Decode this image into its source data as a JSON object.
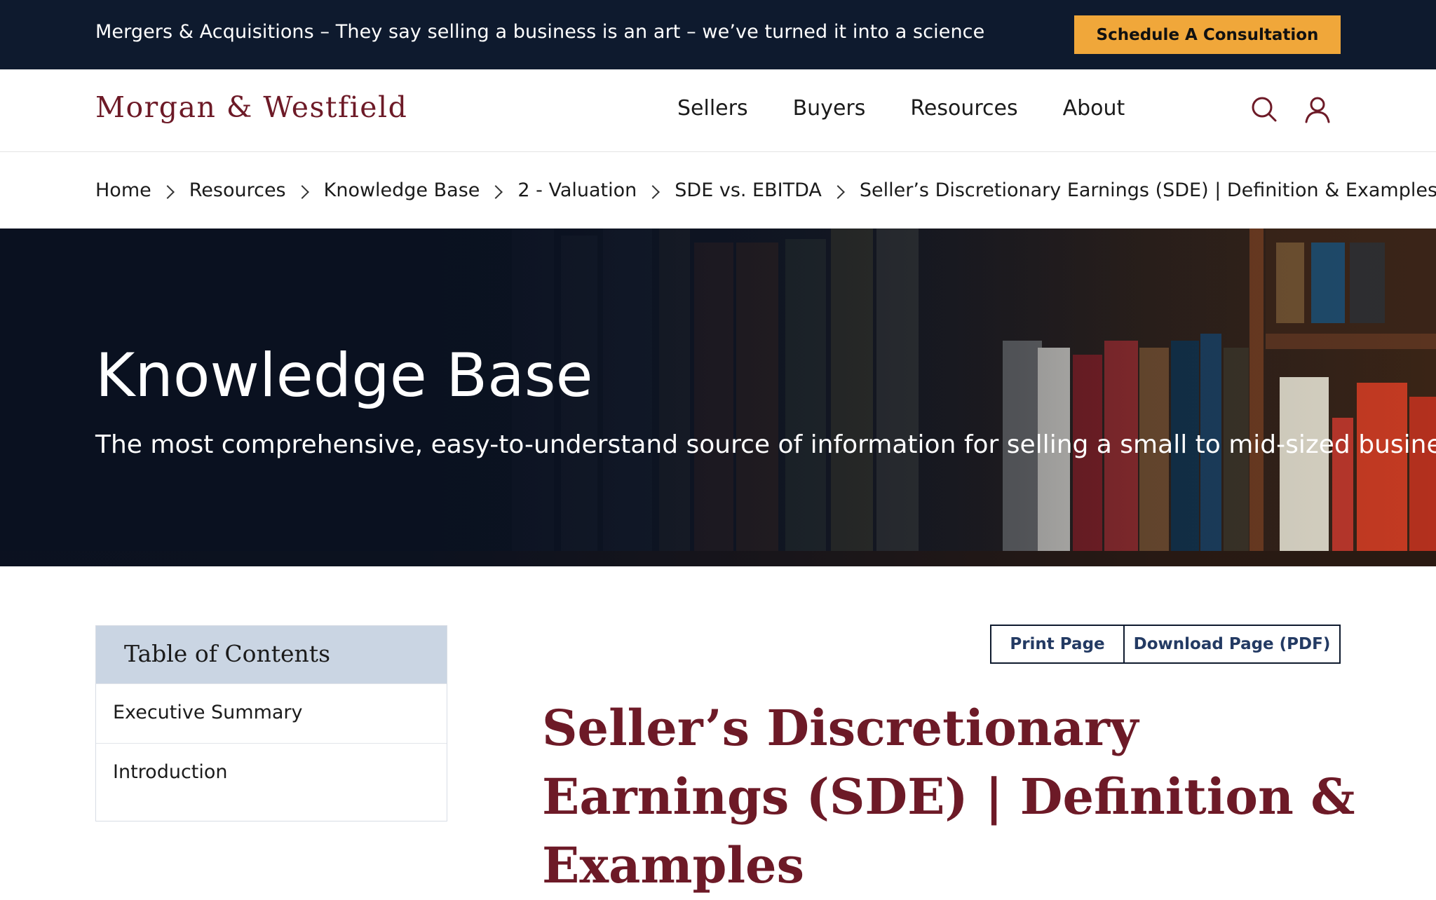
{
  "topbar": {
    "tagline": "Mergers & Acquisitions – They say selling a business is an art – we’ve turned it into a science",
    "cta_label": "Schedule A Consultation"
  },
  "header": {
    "logo": "Morgan & Westfield",
    "nav": [
      "Sellers",
      "Buyers",
      "Resources",
      "About"
    ],
    "icons": [
      "search-icon",
      "user-icon"
    ]
  },
  "breadcrumb": {
    "items": [
      "Home",
      "Resources",
      "Knowledge Base",
      "2 - Valuation",
      "SDE vs. EBITDA"
    ],
    "current": "Seller’s Discretionary Earnings (SDE) | Definition & Examples"
  },
  "hero": {
    "title": "Knowledge Base",
    "subtitle": "The most comprehensive, easy-to-understand source of information for selling a small to mid-sized business."
  },
  "toc": {
    "heading": "Table of Contents",
    "items": [
      "Executive Summary",
      "Introduction"
    ]
  },
  "actions": {
    "print_label": "Print Page",
    "pdf_label": "Download Page (PDF)"
  },
  "article": {
    "title": "Seller’s Discretionary Earnings (SDE) | Definition & Examples"
  },
  "colors": {
    "navy": "#0e1a2e",
    "gold": "#f0a73a",
    "maroon": "#6d1a27",
    "toc_header": "#cad5e3"
  }
}
